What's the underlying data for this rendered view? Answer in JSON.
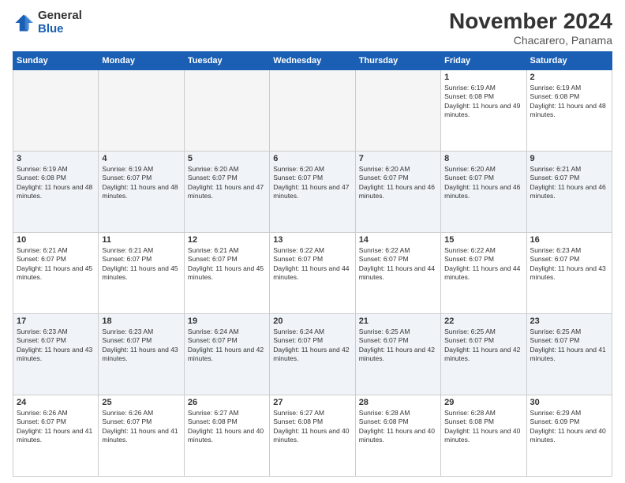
{
  "logo": {
    "general": "General",
    "blue": "Blue"
  },
  "header": {
    "title": "November 2024",
    "subtitle": "Chacarero, Panama"
  },
  "weekdays": [
    "Sunday",
    "Monday",
    "Tuesday",
    "Wednesday",
    "Thursday",
    "Friday",
    "Saturday"
  ],
  "weeks": [
    [
      {
        "day": "",
        "info": ""
      },
      {
        "day": "",
        "info": ""
      },
      {
        "day": "",
        "info": ""
      },
      {
        "day": "",
        "info": ""
      },
      {
        "day": "",
        "info": ""
      },
      {
        "day": "1",
        "info": "Sunrise: 6:19 AM\nSunset: 6:08 PM\nDaylight: 11 hours and 49 minutes."
      },
      {
        "day": "2",
        "info": "Sunrise: 6:19 AM\nSunset: 6:08 PM\nDaylight: 11 hours and 48 minutes."
      }
    ],
    [
      {
        "day": "3",
        "info": "Sunrise: 6:19 AM\nSunset: 6:08 PM\nDaylight: 11 hours and 48 minutes."
      },
      {
        "day": "4",
        "info": "Sunrise: 6:19 AM\nSunset: 6:07 PM\nDaylight: 11 hours and 48 minutes."
      },
      {
        "day": "5",
        "info": "Sunrise: 6:20 AM\nSunset: 6:07 PM\nDaylight: 11 hours and 47 minutes."
      },
      {
        "day": "6",
        "info": "Sunrise: 6:20 AM\nSunset: 6:07 PM\nDaylight: 11 hours and 47 minutes."
      },
      {
        "day": "7",
        "info": "Sunrise: 6:20 AM\nSunset: 6:07 PM\nDaylight: 11 hours and 46 minutes."
      },
      {
        "day": "8",
        "info": "Sunrise: 6:20 AM\nSunset: 6:07 PM\nDaylight: 11 hours and 46 minutes."
      },
      {
        "day": "9",
        "info": "Sunrise: 6:21 AM\nSunset: 6:07 PM\nDaylight: 11 hours and 46 minutes."
      }
    ],
    [
      {
        "day": "10",
        "info": "Sunrise: 6:21 AM\nSunset: 6:07 PM\nDaylight: 11 hours and 45 minutes."
      },
      {
        "day": "11",
        "info": "Sunrise: 6:21 AM\nSunset: 6:07 PM\nDaylight: 11 hours and 45 minutes."
      },
      {
        "day": "12",
        "info": "Sunrise: 6:21 AM\nSunset: 6:07 PM\nDaylight: 11 hours and 45 minutes."
      },
      {
        "day": "13",
        "info": "Sunrise: 6:22 AM\nSunset: 6:07 PM\nDaylight: 11 hours and 44 minutes."
      },
      {
        "day": "14",
        "info": "Sunrise: 6:22 AM\nSunset: 6:07 PM\nDaylight: 11 hours and 44 minutes."
      },
      {
        "day": "15",
        "info": "Sunrise: 6:22 AM\nSunset: 6:07 PM\nDaylight: 11 hours and 44 minutes."
      },
      {
        "day": "16",
        "info": "Sunrise: 6:23 AM\nSunset: 6:07 PM\nDaylight: 11 hours and 43 minutes."
      }
    ],
    [
      {
        "day": "17",
        "info": "Sunrise: 6:23 AM\nSunset: 6:07 PM\nDaylight: 11 hours and 43 minutes."
      },
      {
        "day": "18",
        "info": "Sunrise: 6:23 AM\nSunset: 6:07 PM\nDaylight: 11 hours and 43 minutes."
      },
      {
        "day": "19",
        "info": "Sunrise: 6:24 AM\nSunset: 6:07 PM\nDaylight: 11 hours and 42 minutes."
      },
      {
        "day": "20",
        "info": "Sunrise: 6:24 AM\nSunset: 6:07 PM\nDaylight: 11 hours and 42 minutes."
      },
      {
        "day": "21",
        "info": "Sunrise: 6:25 AM\nSunset: 6:07 PM\nDaylight: 11 hours and 42 minutes."
      },
      {
        "day": "22",
        "info": "Sunrise: 6:25 AM\nSunset: 6:07 PM\nDaylight: 11 hours and 42 minutes."
      },
      {
        "day": "23",
        "info": "Sunrise: 6:25 AM\nSunset: 6:07 PM\nDaylight: 11 hours and 41 minutes."
      }
    ],
    [
      {
        "day": "24",
        "info": "Sunrise: 6:26 AM\nSunset: 6:07 PM\nDaylight: 11 hours and 41 minutes."
      },
      {
        "day": "25",
        "info": "Sunrise: 6:26 AM\nSunset: 6:07 PM\nDaylight: 11 hours and 41 minutes."
      },
      {
        "day": "26",
        "info": "Sunrise: 6:27 AM\nSunset: 6:08 PM\nDaylight: 11 hours and 40 minutes."
      },
      {
        "day": "27",
        "info": "Sunrise: 6:27 AM\nSunset: 6:08 PM\nDaylight: 11 hours and 40 minutes."
      },
      {
        "day": "28",
        "info": "Sunrise: 6:28 AM\nSunset: 6:08 PM\nDaylight: 11 hours and 40 minutes."
      },
      {
        "day": "29",
        "info": "Sunrise: 6:28 AM\nSunset: 6:08 PM\nDaylight: 11 hours and 40 minutes."
      },
      {
        "day": "30",
        "info": "Sunrise: 6:29 AM\nSunset: 6:09 PM\nDaylight: 11 hours and 40 minutes."
      }
    ]
  ]
}
